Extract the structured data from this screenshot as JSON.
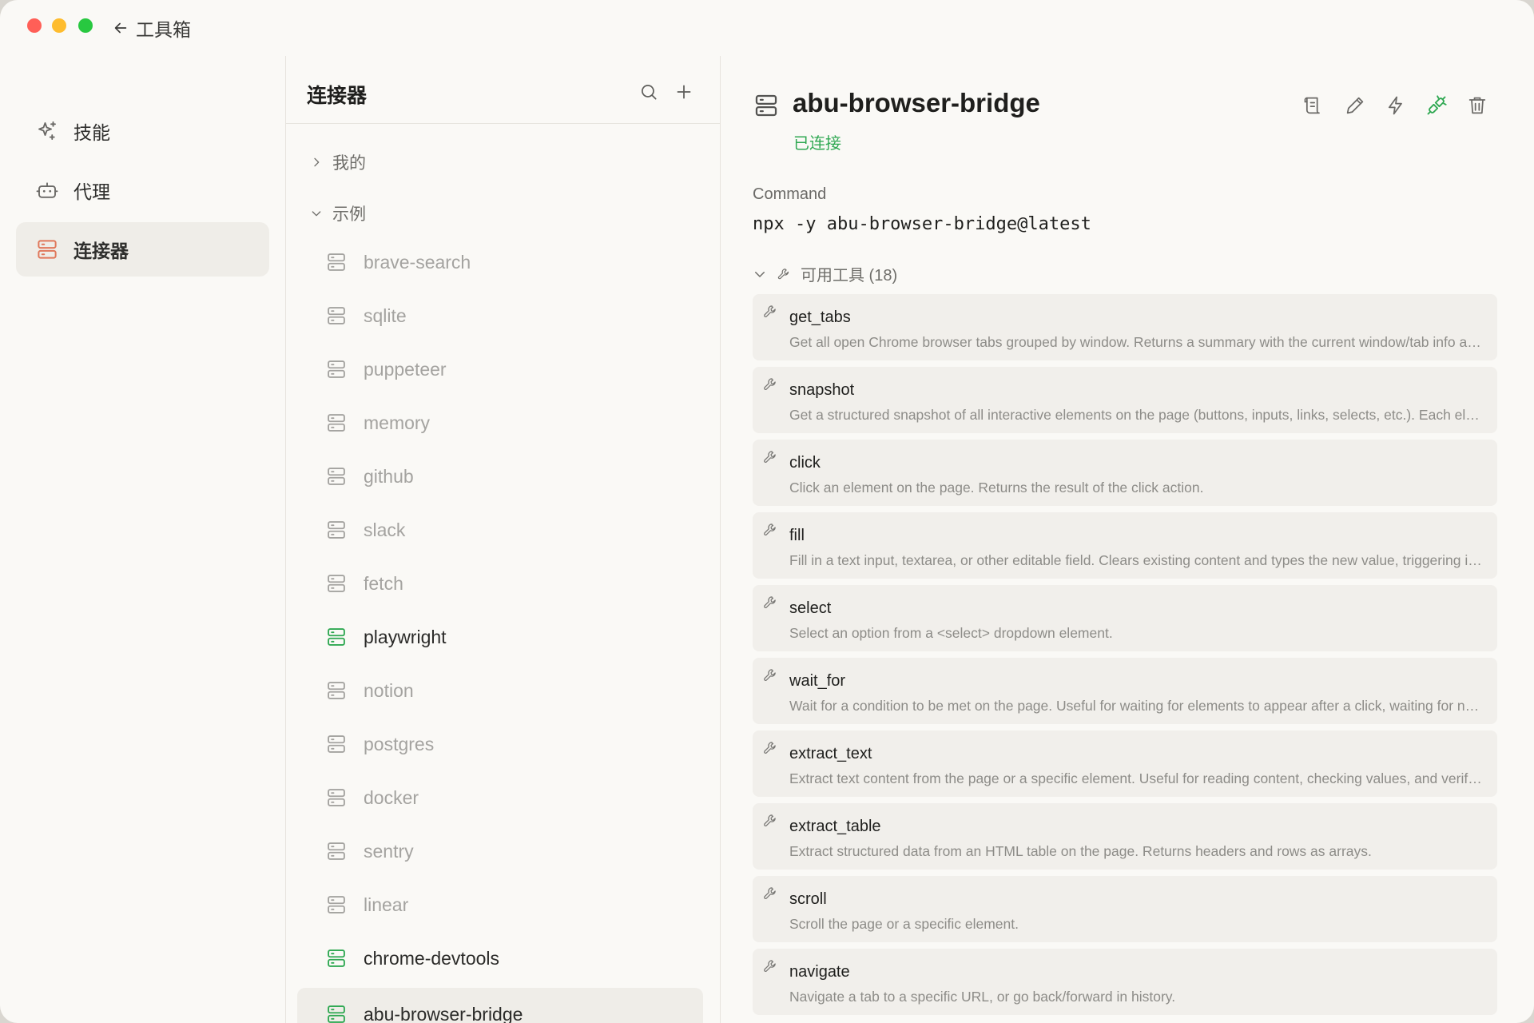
{
  "window": {
    "back_label": "工具箱"
  },
  "sidebar": {
    "items": [
      {
        "label": "技能"
      },
      {
        "label": "代理"
      },
      {
        "label": "连接器"
      }
    ]
  },
  "connectors": {
    "title": "连接器",
    "groups": [
      {
        "label": "我的"
      },
      {
        "label": "示例"
      }
    ],
    "items": [
      {
        "name": "brave-search",
        "status": "disconnected"
      },
      {
        "name": "sqlite",
        "status": "disconnected"
      },
      {
        "name": "puppeteer",
        "status": "disconnected"
      },
      {
        "name": "memory",
        "status": "disconnected"
      },
      {
        "name": "github",
        "status": "disconnected"
      },
      {
        "name": "slack",
        "status": "disconnected"
      },
      {
        "name": "fetch",
        "status": "disconnected"
      },
      {
        "name": "playwright",
        "status": "connected"
      },
      {
        "name": "notion",
        "status": "disconnected"
      },
      {
        "name": "postgres",
        "status": "disconnected"
      },
      {
        "name": "docker",
        "status": "disconnected"
      },
      {
        "name": "sentry",
        "status": "disconnected"
      },
      {
        "name": "linear",
        "status": "disconnected"
      },
      {
        "name": "chrome-devtools",
        "status": "connected"
      },
      {
        "name": "abu-browser-bridge",
        "status": "connected",
        "selected": true
      }
    ]
  },
  "detail": {
    "name": "abu-browser-bridge",
    "status": "已连接",
    "command_label": "Command",
    "command": "npx -y abu-browser-bridge@latest",
    "tools_header": "可用工具 (18)",
    "tools": [
      {
        "name": "get_tabs",
        "desc": "Get all open Chrome browser tabs grouped by window. Returns a summary with the current window/tab info and a list of all tabs"
      },
      {
        "name": "snapshot",
        "desc": "Get a structured snapshot of all interactive elements on the page (buttons, inputs, links, selects, etc.). Each element gets a ref id"
      },
      {
        "name": "click",
        "desc": "Click an element on the page. Returns the result of the click action."
      },
      {
        "name": "fill",
        "desc": "Fill in a text input, textarea, or other editable field. Clears existing content and types the new value, triggering input events"
      },
      {
        "name": "select",
        "desc": "Select an option from a <select> dropdown element."
      },
      {
        "name": "wait_for",
        "desc": "Wait for a condition to be met on the page. Useful for waiting for elements to appear after a click, waiting for navigation"
      },
      {
        "name": "extract_text",
        "desc": "Extract text content from the page or a specific element. Useful for reading content, checking values, and verifying results"
      },
      {
        "name": "extract_table",
        "desc": "Extract structured data from an HTML table on the page. Returns headers and rows as arrays."
      },
      {
        "name": "scroll",
        "desc": "Scroll the page or a specific element."
      },
      {
        "name": "navigate",
        "desc": "Navigate a tab to a specific URL, or go back/forward in history."
      }
    ]
  },
  "colors": {
    "connected": "#2fa852",
    "accent_icon": "#e0775a"
  }
}
